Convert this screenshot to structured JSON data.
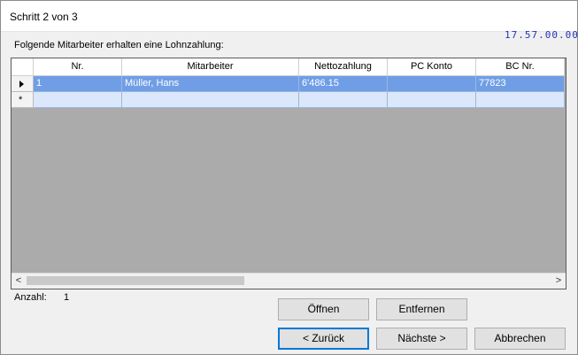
{
  "window": {
    "title": "Schritt 2 von 3"
  },
  "background_text": "17.57.00.000",
  "intro_label": "Folgende Mitarbeiter erhalten eine Lohnzahlung:",
  "grid": {
    "columns": [
      "Nr.",
      "Mitarbeiter",
      "Nettozahlung",
      "PC Konto",
      "BC Nr."
    ],
    "rows": [
      {
        "nr": "1",
        "mitarbeiter": "Müller, Hans",
        "nettozahlung": "6'486.15",
        "pc_konto": "",
        "bc_nr": "77823"
      }
    ],
    "new_row_marker": "*",
    "scroll_left_glyph": "<",
    "scroll_right_glyph": ">"
  },
  "footer": {
    "anzahl_label": "Anzahl:",
    "anzahl_value": "1"
  },
  "buttons": {
    "open": "Öffnen",
    "remove": "Entfernen",
    "back": "< Zurück",
    "next": "Nächste >",
    "cancel": "Abbrechen"
  }
}
